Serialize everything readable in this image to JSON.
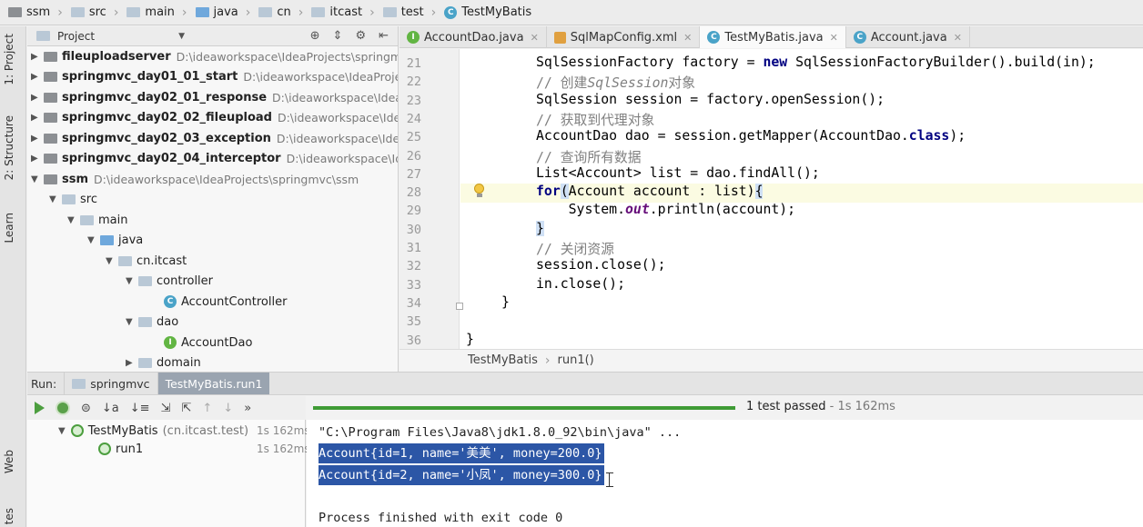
{
  "navbar": {
    "crumbs": [
      "ssm",
      "src",
      "main",
      "java",
      "cn",
      "itcast",
      "test",
      "TestMyBatis"
    ]
  },
  "sidebar": {
    "tabs": [
      "1: Project",
      "2: Structure",
      "Learn",
      "Web",
      "tes"
    ]
  },
  "project": {
    "header": "Project",
    "tree": [
      {
        "label": "fileuploadserver",
        "path": "D:\\ideaworkspace\\IdeaProjects\\springm"
      },
      {
        "label": "springmvc_day01_01_start",
        "path": "D:\\ideaworkspace\\IdeaProjects"
      },
      {
        "label": "springmvc_day02_01_response",
        "path": "D:\\ideaworkspace\\IdeaPro"
      },
      {
        "label": "springmvc_day02_02_fileupload",
        "path": "D:\\ideaworkspace\\IdeaP"
      },
      {
        "label": "springmvc_day02_03_exception",
        "path": "D:\\ideaworkspace\\IdeaPr"
      },
      {
        "label": "springmvc_day02_04_interceptor",
        "path": "D:\\ideaworkspace\\IdeaI"
      },
      {
        "label": "ssm",
        "path": "D:\\ideaworkspace\\IdeaProjects\\springmvc\\ssm"
      },
      {
        "label": "src",
        "path": ""
      },
      {
        "label": "main",
        "path": ""
      },
      {
        "label": "java",
        "path": ""
      },
      {
        "label": "cn.itcast",
        "path": ""
      },
      {
        "label": "controller",
        "path": ""
      },
      {
        "label": "AccountController",
        "path": ""
      },
      {
        "label": "dao",
        "path": ""
      },
      {
        "label": "AccountDao",
        "path": ""
      },
      {
        "label": "domain",
        "path": ""
      }
    ]
  },
  "editor": {
    "tabs": [
      "AccountDao.java",
      "SqlMapConfig.xml",
      "TestMyBatis.java",
      "Account.java"
    ],
    "active_tab": "TestMyBatis.java",
    "line_numbers": [
      "21",
      "22",
      "23",
      "24",
      "25",
      "26",
      "27",
      "28",
      "29",
      "30",
      "31",
      "32",
      "33",
      "34",
      "35",
      "36"
    ],
    "lines": {
      "l21a": "SqlSessionFactory factory = ",
      "l21kw": "new",
      "l21b": " SqlSessionFactoryBuilder().build(in);",
      "l22a": "// 创建",
      "l22it": "SqlSession",
      "l22b": "对象",
      "l23": "SqlSession session = factory.openSession();",
      "l24": "// 获取到代理对象",
      "l25a": "AccountDao dao = session.getMapper(AccountDao.",
      "l25kw": "class",
      "l25b": ");",
      "l26": "// 查询所有数据",
      "l27": "List<Account> list = dao.findAll();",
      "l28kw": "for",
      "l28a": "(",
      "l28b": "Account account : list)",
      "l28c": "{",
      "l29a": "    System.",
      "l29it": "out",
      "l29b": ".println(account);",
      "l30": "}",
      "l31": "// 关闭资源",
      "l32": "session.close();",
      "l33": "in.close();",
      "l34": "}",
      "l36": "}"
    },
    "breadcrumb": [
      "TestMyBatis",
      "run1()"
    ]
  },
  "run": {
    "label": "Run:",
    "tabs": [
      "springmvc",
      "TestMyBatis.run1"
    ],
    "status": "1 test passed",
    "status_time": " - 1s 162ms",
    "results": [
      {
        "label": "TestMyBatis",
        "sub": "(cn.itcast.test)",
        "time": "1s 162ms"
      },
      {
        "label": "run1",
        "sub": "",
        "time": "1s 162ms"
      }
    ],
    "console": [
      "\"C:\\Program Files\\Java8\\jdk1.8.0_92\\bin\\java\" ...",
      "Account{id=1, name='美美', money=200.0}",
      "Account{id=2, name='小凤', money=300.0}",
      "",
      "Process finished with exit code 0"
    ]
  },
  "colors": {
    "selection": "#2c56a6",
    "pass_green": "#3f9b35",
    "keyword": "#000080"
  }
}
